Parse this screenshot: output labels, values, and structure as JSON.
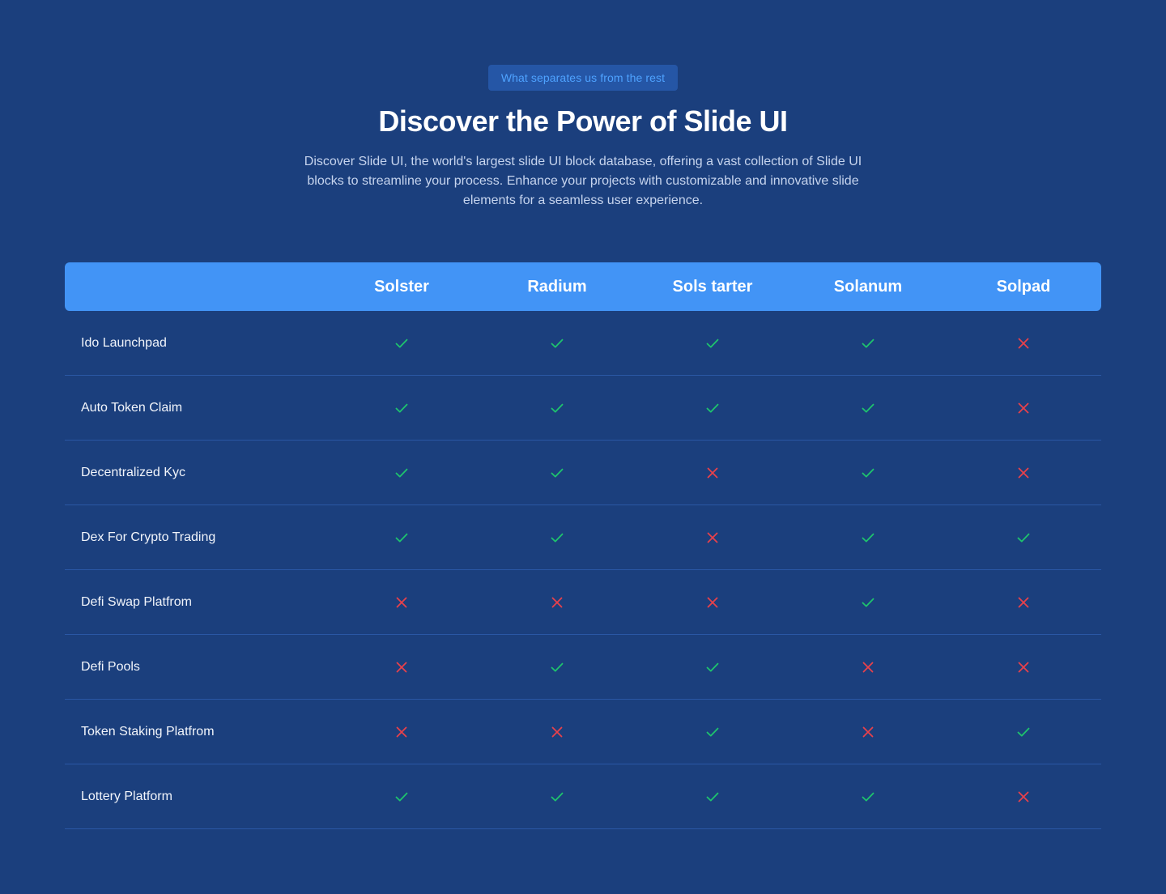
{
  "header": {
    "badge": "What separates us from the rest",
    "title": "Discover the Power of Slide UI",
    "subtitle": "Discover Slide UI, the world's largest slide UI block database, offering a vast collection of Slide UI blocks to streamline your process. Enhance your projects with customizable and innovative slide elements for a seamless user experience."
  },
  "colors": {
    "background": "#1b3f7d",
    "header_bar": "#4294f6",
    "check": "#1ec46d",
    "cross": "#e8414b"
  },
  "icons": {
    "yes": "check-icon",
    "no": "cross-icon"
  },
  "table": {
    "columns": [
      "Solster",
      "Radium",
      "Sols tarter",
      "Solanum",
      "Solpad"
    ],
    "rows": [
      {
        "feature": "Ido Launchpad",
        "values": [
          true,
          true,
          true,
          true,
          false
        ]
      },
      {
        "feature": "Auto Token Claim",
        "values": [
          true,
          true,
          true,
          true,
          false
        ]
      },
      {
        "feature": "Decentralized Kyc",
        "values": [
          true,
          true,
          false,
          true,
          false
        ]
      },
      {
        "feature": "Dex For Crypto Trading",
        "values": [
          true,
          true,
          false,
          true,
          true
        ]
      },
      {
        "feature": "Defi Swap Platfrom",
        "values": [
          false,
          false,
          false,
          true,
          false
        ]
      },
      {
        "feature": "Defi Pools",
        "values": [
          false,
          true,
          true,
          false,
          false
        ]
      },
      {
        "feature": "Token Staking Platfrom",
        "values": [
          false,
          false,
          true,
          false,
          true
        ]
      },
      {
        "feature": "Lottery Platform",
        "values": [
          true,
          true,
          true,
          true,
          false
        ]
      }
    ]
  }
}
